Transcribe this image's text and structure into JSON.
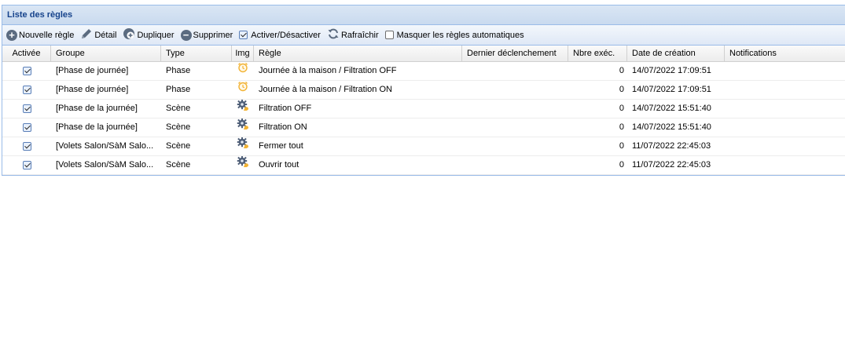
{
  "panel": {
    "title": "Liste des règles"
  },
  "toolbar": {
    "new_label": "Nouvelle règle",
    "detail_label": "Détail",
    "duplicate_label": "Dupliquer",
    "delete_label": "Supprimer",
    "toggle_label": "Activer/Désactiver",
    "refresh_label": "Rafraîchir",
    "hide_auto_label": "Masquer les règles automatiques"
  },
  "columns": {
    "activee": "Activée",
    "groupe": "Groupe",
    "type": "Type",
    "img": "Img",
    "regle": "Règle",
    "dernier": "Dernier déclenchement",
    "nbre": "Nbre exéc.",
    "date": "Date de création",
    "notifications": "Notifications"
  },
  "rows": [
    {
      "activee": true,
      "groupe": "[Phase de journée]",
      "type": "Phase",
      "icon": "alarm-clock-icon",
      "regle": "Journée à la maison / Filtration OFF",
      "dernier": "",
      "nbre": "0",
      "date": "14/07/2022 17:09:51",
      "notifications": ""
    },
    {
      "activee": true,
      "groupe": "[Phase de journée]",
      "type": "Phase",
      "icon": "alarm-clock-icon",
      "regle": "Journée à la maison / Filtration ON",
      "dernier": "",
      "nbre": "0",
      "date": "14/07/2022 17:09:51",
      "notifications": ""
    },
    {
      "activee": true,
      "groupe": "[Phase de la journée]",
      "type": "Scène",
      "icon": "scene-gear-icon",
      "regle": "Filtration OFF",
      "dernier": "",
      "nbre": "0",
      "date": "14/07/2022 15:51:40",
      "notifications": ""
    },
    {
      "activee": true,
      "groupe": "[Phase de la journée]",
      "type": "Scène",
      "icon": "scene-gear-icon",
      "regle": "Filtration ON",
      "dernier": "",
      "nbre": "0",
      "date": "14/07/2022 15:51:40",
      "notifications": ""
    },
    {
      "activee": true,
      "groupe": "[Volets Salon/SàM Salo...",
      "type": "Scène",
      "icon": "scene-gear-icon",
      "regle": "Fermer tout",
      "dernier": "",
      "nbre": "0",
      "date": "11/07/2022 22:45:03",
      "notifications": ""
    },
    {
      "activee": true,
      "groupe": "[Volets Salon/SàM Salo...",
      "type": "Scène",
      "icon": "scene-gear-icon",
      "regle": "Ouvrir tout",
      "dernier": "",
      "nbre": "0",
      "date": "11/07/2022 22:45:03",
      "notifications": ""
    }
  ],
  "colors": {
    "accent": "#15428b",
    "border": "#99bbe8",
    "clock": "#f2b233",
    "gear": "#4f5f78"
  }
}
